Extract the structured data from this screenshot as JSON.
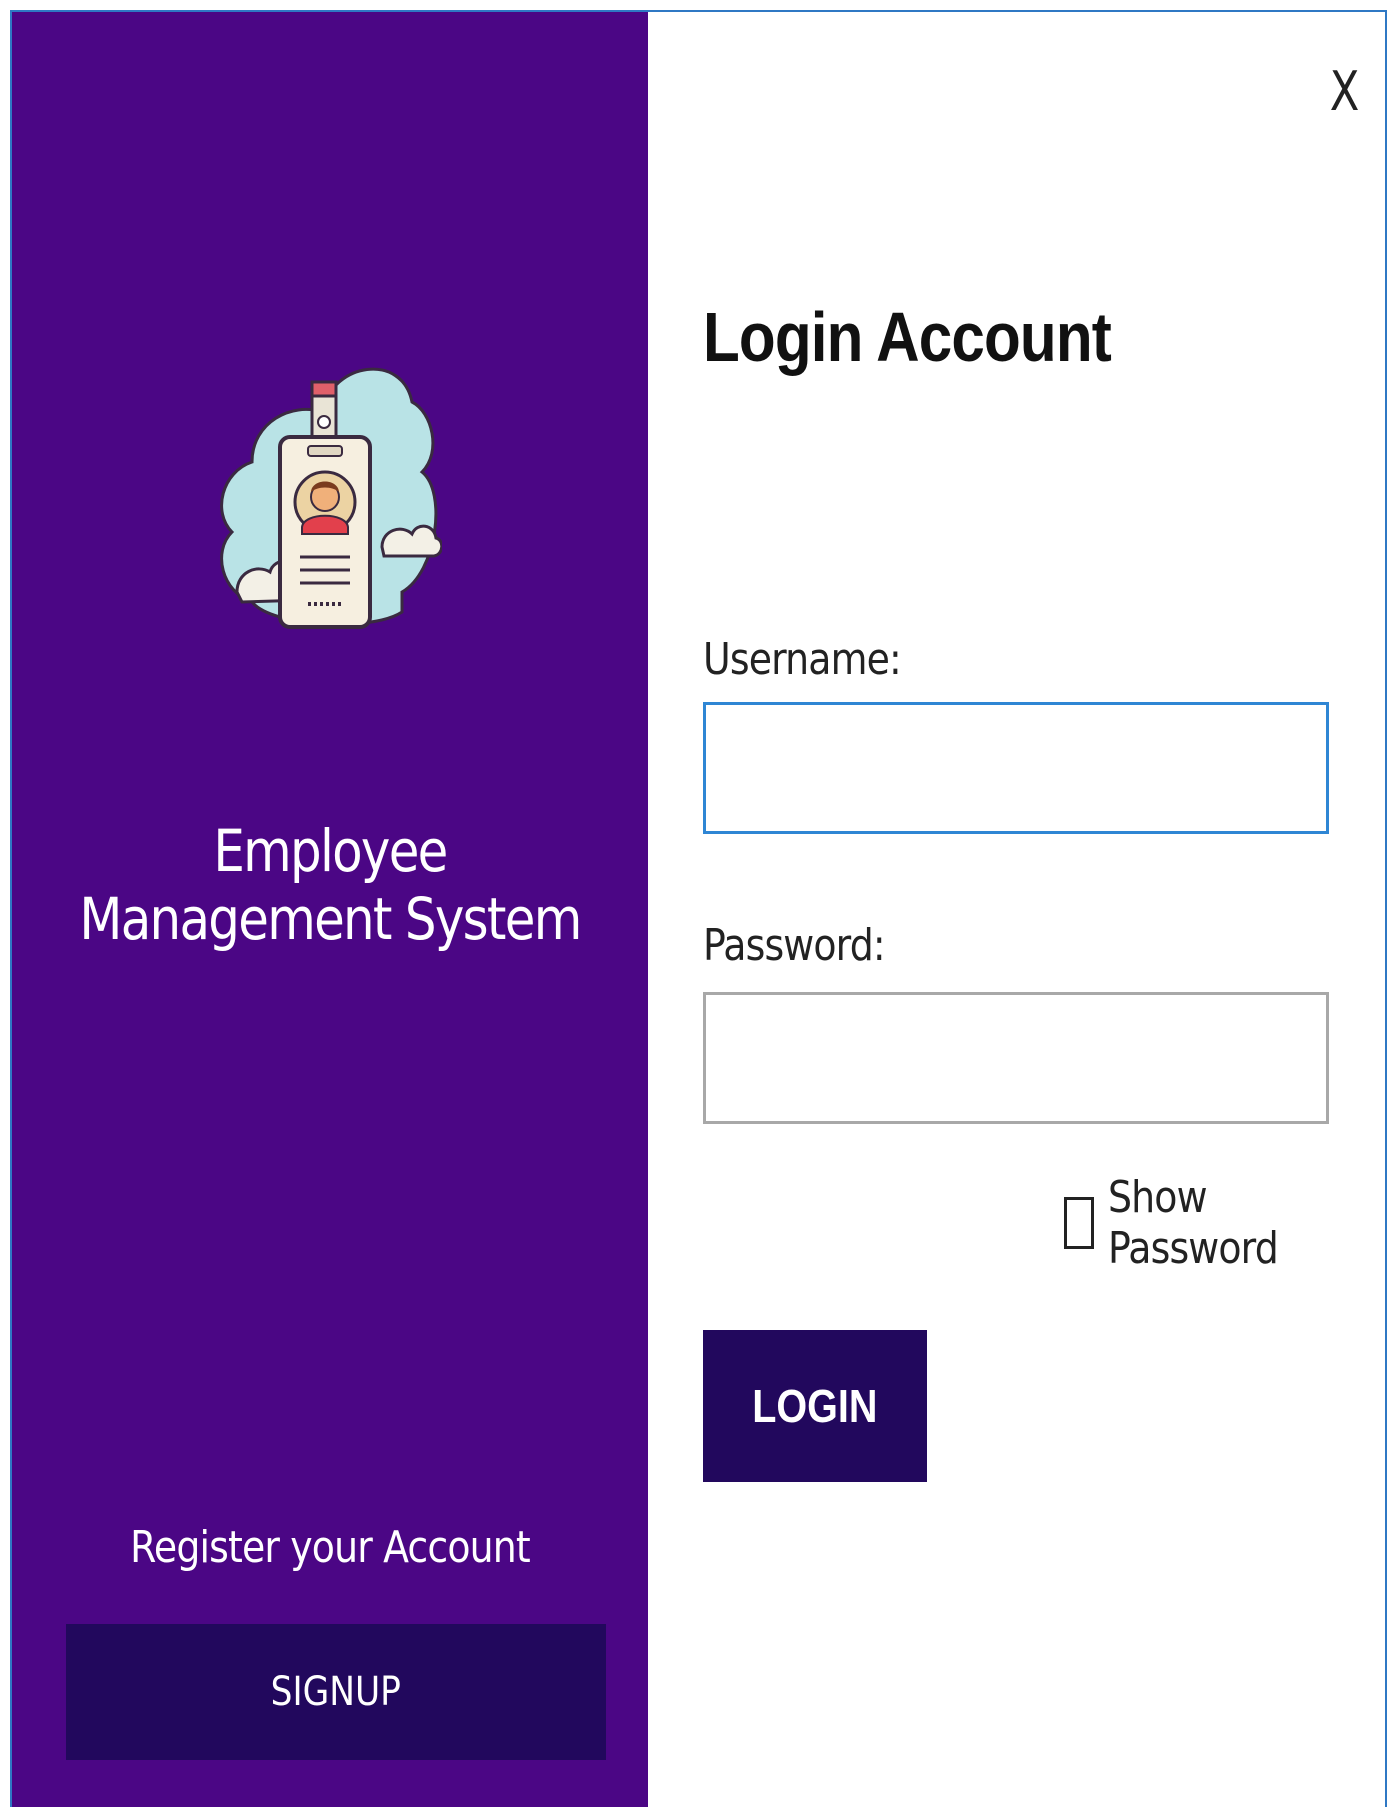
{
  "sidebar": {
    "logo_icon": "employee-id-badge-cloud-icon",
    "app_title": "Employee Management System",
    "register_text": "Register your Account",
    "signup_label": "SIGNUP",
    "background_color": "#4b0685",
    "button_color": "#22085d"
  },
  "login": {
    "close_label": "X",
    "title": "Login Account",
    "username_label": "Username:",
    "username_value": "",
    "password_label": "Password:",
    "password_value": "",
    "show_password_label": "Show Password",
    "show_password_checked": false,
    "login_label": "LOGIN",
    "accent_color": "#2f86d4"
  }
}
